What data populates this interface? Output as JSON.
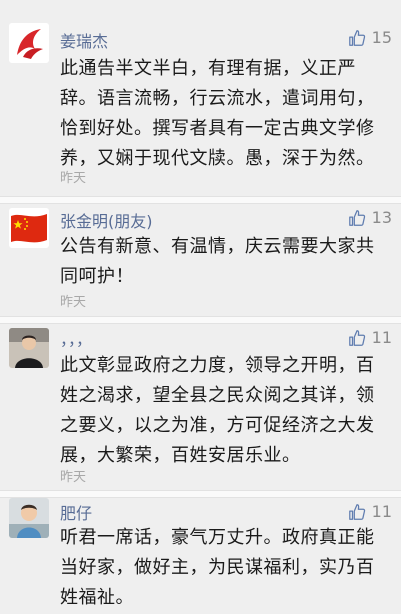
{
  "comments": [
    {
      "user": "姜瑞杰",
      "likes": "15",
      "lines": [
        "此通告半文半白，有理有据，义正严",
        "辞。语言流畅，行云流水，遣词用句，",
        "恰到好处。撰写者具有一定古典文学修",
        "养，又娴于现代文牍。愚，深于为然。"
      ],
      "time": "昨天",
      "avatar_icon": "red-flame-icon"
    },
    {
      "user": "张金明(朋友)",
      "likes": "13",
      "lines": [
        "公告有新意、有温情，庆云需要大家共",
        "同呵护！"
      ],
      "time": "昨天",
      "avatar_icon": "china-flag-icon"
    },
    {
      "user": "，，，",
      "likes": "11",
      "lines": [
        "此文彰显政府之力度，领导之开明，百",
        "姓之渴求，望全县之民众阅之其详，领",
        "之要义，以之为准，方可促经济之大发",
        "展，大繁荣，百姓安居乐业。"
      ],
      "time": "昨天",
      "avatar_icon": "person-photo-icon"
    },
    {
      "user": "肥仔",
      "likes": "11",
      "lines": [
        "听君一席话，豪气万丈升。政府真正能",
        "当好家，做好主，为民谋福利，实乃百",
        "姓福祉。"
      ],
      "time": "",
      "avatar_icon": "child-photo-icon"
    }
  ],
  "colors": {
    "name": "#586c95",
    "background": "#efefef",
    "like": "#8a8a8a"
  }
}
